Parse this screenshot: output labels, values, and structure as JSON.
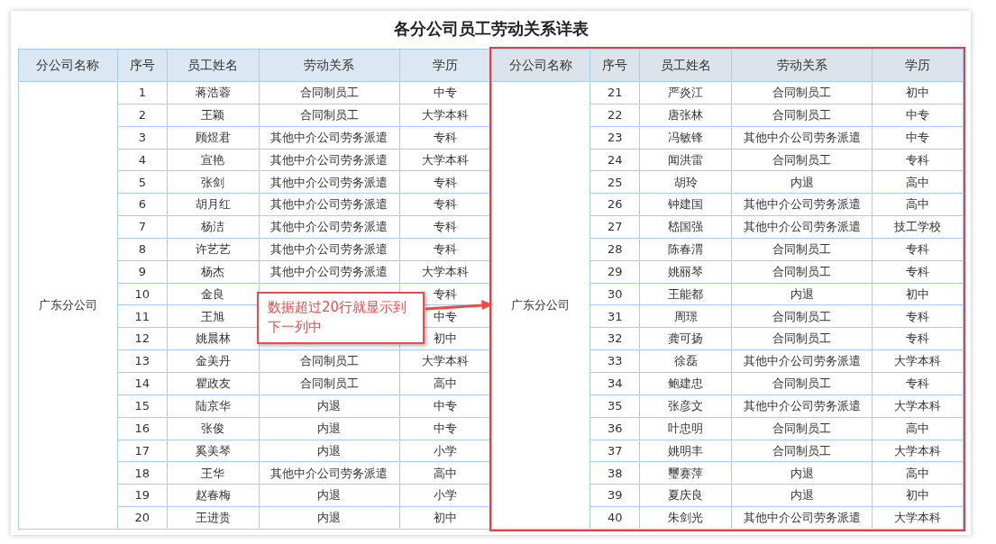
{
  "title": "各分公司员工劳动关系详表",
  "tables": [
    {
      "highlighted": false,
      "columns": [
        "分公司名称",
        "序号",
        "员工姓名",
        "劳动关系",
        "学历"
      ],
      "company": "广东分公司",
      "rows": [
        {
          "no": "1",
          "name": "蒋浩蓉",
          "relation": "合同制员工",
          "education": "中专"
        },
        {
          "no": "2",
          "name": "王颖",
          "relation": "合同制员工",
          "education": "大学本科"
        },
        {
          "no": "3",
          "name": "顾煜君",
          "relation": "其他中介公司劳务派遣",
          "education": "专科"
        },
        {
          "no": "4",
          "name": "宣艳",
          "relation": "其他中介公司劳务派遣",
          "education": "大学本科"
        },
        {
          "no": "5",
          "name": "张剑",
          "relation": "其他中介公司劳务派遣",
          "education": "专科"
        },
        {
          "no": "6",
          "name": "胡月红",
          "relation": "其他中介公司劳务派遣",
          "education": "专科"
        },
        {
          "no": "7",
          "name": "杨洁",
          "relation": "其他中介公司劳务派遣",
          "education": "专科"
        },
        {
          "no": "8",
          "name": "许艺艺",
          "relation": "其他中介公司劳务派遣",
          "education": "专科"
        },
        {
          "no": "9",
          "name": "杨杰",
          "relation": "其他中介公司劳务派遣",
          "education": "大学本科"
        },
        {
          "no": "10",
          "name": "金良",
          "education": "专科"
        },
        {
          "no": "11",
          "name": "王旭",
          "education": "中专"
        },
        {
          "no": "12",
          "name": "姚晨林",
          "education": "初中"
        },
        {
          "no": "13",
          "name": "金美丹",
          "relation": "合同制员工",
          "education": "大学本科"
        },
        {
          "no": "14",
          "name": "瞿政友",
          "relation": "合同制员工",
          "education": "高中"
        },
        {
          "no": "15",
          "name": "陆京华",
          "relation": "内退",
          "education": "中专"
        },
        {
          "no": "16",
          "name": "张俊",
          "relation": "内退",
          "education": "中专"
        },
        {
          "no": "17",
          "name": "奚美琴",
          "relation": "内退",
          "education": "小学"
        },
        {
          "no": "18",
          "name": "王华",
          "relation": "其他中介公司劳务派遣",
          "education": "高中"
        },
        {
          "no": "19",
          "name": "赵春梅",
          "relation": "内退",
          "education": "小学"
        },
        {
          "no": "20",
          "name": "王进贵",
          "relation": "内退",
          "education": "初中"
        }
      ]
    },
    {
      "highlighted": true,
      "columns": [
        "分公司名称",
        "序号",
        "员工姓名",
        "劳动关系",
        "学历"
      ],
      "company": "广东分公司",
      "rows": [
        {
          "no": "21",
          "name": "严炎江",
          "relation": "合同制员工",
          "education": "初中"
        },
        {
          "no": "22",
          "name": "唐张林",
          "relation": "合同制员工",
          "education": "中专"
        },
        {
          "no": "23",
          "name": "冯敏锋",
          "relation": "其他中介公司劳务派遣",
          "education": "中专"
        },
        {
          "no": "24",
          "name": "闻洪雷",
          "relation": "合同制员工",
          "education": "专科"
        },
        {
          "no": "25",
          "name": "胡玲",
          "relation": "内退",
          "education": "高中"
        },
        {
          "no": "26",
          "name": "钟建国",
          "relation": "其他中介公司劳务派遣",
          "education": "高中"
        },
        {
          "no": "27",
          "name": "嵇国强",
          "relation": "其他中介公司劳务派遣",
          "education": "技工学校"
        },
        {
          "no": "28",
          "name": "陈春渭",
          "relation": "合同制员工",
          "education": "专科"
        },
        {
          "no": "29",
          "name": "姚丽琴",
          "relation": "合同制员工",
          "education": "专科"
        },
        {
          "no": "30",
          "name": "王能都",
          "relation": "内退",
          "education": "初中"
        },
        {
          "no": "31",
          "name": "周璟",
          "relation": "合同制员工",
          "education": "专科"
        },
        {
          "no": "32",
          "name": "龚可扬",
          "relation": "合同制员工",
          "education": "专科"
        },
        {
          "no": "33",
          "name": "徐磊",
          "relation": "其他中介公司劳务派遣",
          "education": "大学本科"
        },
        {
          "no": "34",
          "name": "鲍建忠",
          "relation": "合同制员工",
          "education": "专科"
        },
        {
          "no": "35",
          "name": "张彦文",
          "relation": "其他中介公司劳务派遣",
          "education": "大学本科"
        },
        {
          "no": "36",
          "name": "叶忠明",
          "relation": "合同制员工",
          "education": "高中"
        },
        {
          "no": "37",
          "name": "姚明丰",
          "relation": "合同制员工",
          "education": "大学本科"
        },
        {
          "no": "38",
          "name": "璽赛萍",
          "relation": "内退",
          "education": "高中"
        },
        {
          "no": "39",
          "name": "夏庆良",
          "relation": "内退",
          "education": "初中"
        },
        {
          "no": "40",
          "name": "朱剑光",
          "relation": "其他中介公司劳务派遣",
          "education": "大学本科"
        }
      ]
    }
  ],
  "callout": {
    "text": "数据超过20行就显示到下一列中"
  }
}
